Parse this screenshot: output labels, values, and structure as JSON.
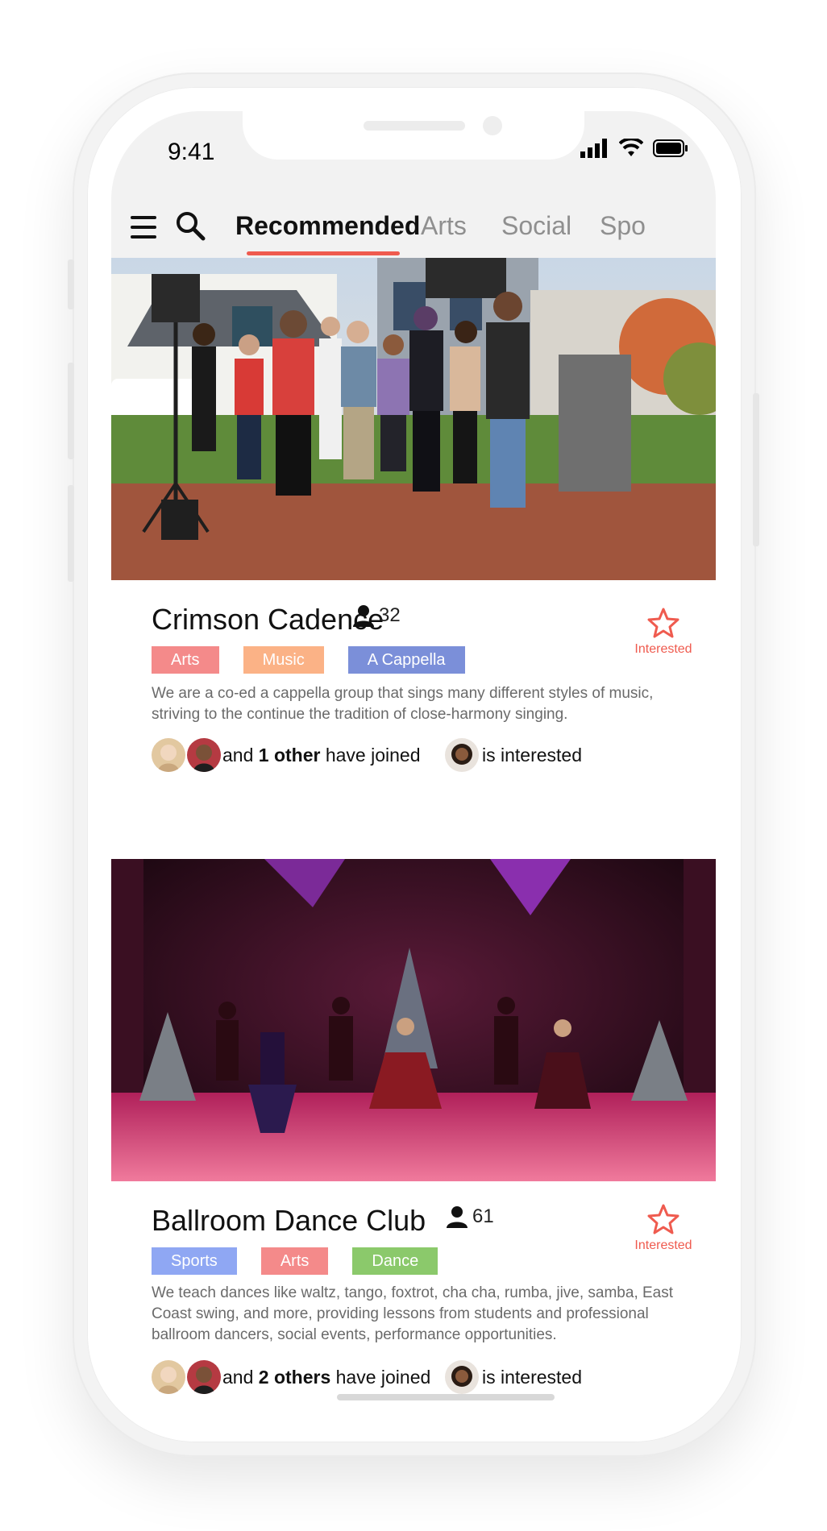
{
  "status_bar": {
    "time": "9:41"
  },
  "header": {
    "tabs": [
      {
        "label": "Recommended",
        "active": true
      },
      {
        "label": "Arts",
        "active": false
      },
      {
        "label": "Social",
        "active": false
      },
      {
        "label": "Spo",
        "active": false
      }
    ]
  },
  "cards": [
    {
      "title": "Crimson Cadence",
      "members": "32",
      "tags": [
        {
          "label": "Arts",
          "color": "#f48a8a"
        },
        {
          "label": "Music",
          "color": "#fbb286"
        },
        {
          "label": "A Cappella",
          "color": "#7b8fd9"
        }
      ],
      "interest_label": "Interested",
      "description": "We are a co-ed a cappella group that sings many different styles of music, striving to the continue the tradition of close-harmony singing.",
      "joined_prefix": "and ",
      "joined_bold": "1 other",
      "joined_suffix": " have joined",
      "interested_text": "is interested"
    },
    {
      "title": "Ballroom Dance Club",
      "members": "61",
      "tags": [
        {
          "label": "Sports",
          "color": "#8fa7f3"
        },
        {
          "label": "Arts",
          "color": "#f48a8a"
        },
        {
          "label": "Dance",
          "color": "#8bc96b"
        }
      ],
      "interest_label": "Interested",
      "description": "We teach dances like waltz, tango, foxtrot, cha cha, rumba, jive, samba, East Coast swing, and more, providing lessons from students and professional ballroom dancers, social events, performance opportunities.",
      "joined_prefix": "and ",
      "joined_bold": "2 others",
      "joined_suffix": " have joined",
      "interested_text": "is interested"
    }
  ],
  "colors": {
    "accent": "#ef5b4f"
  }
}
